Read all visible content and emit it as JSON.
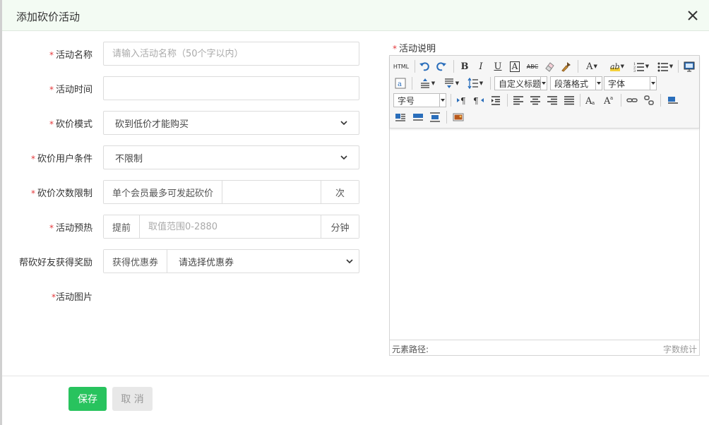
{
  "dialog": {
    "title": "添加砍价活动"
  },
  "form": {
    "name": {
      "label": "活动名称",
      "placeholder": "请输入活动名称（50个字以内）",
      "value": ""
    },
    "time": {
      "label": "活动时间",
      "value": ""
    },
    "mode": {
      "label": "砍价模式",
      "selected": "砍到低价才能购买"
    },
    "user_condition": {
      "label": "砍价用户条件",
      "selected": "不限制"
    },
    "times_limit": {
      "label": "砍价次数限制",
      "prefix": "单个会员最多可发起砍价",
      "value": "",
      "suffix": "次"
    },
    "preheat": {
      "label": "活动预热",
      "prefix": "提前",
      "placeholder": "取值范围0-2880",
      "value": "",
      "suffix": "分钟"
    },
    "help_reward": {
      "label": "帮砍好友获得奖励",
      "prefix": "获得优惠券",
      "selected": "请选择优惠券"
    },
    "image": {
      "label": "活动图片"
    },
    "required_mark": "*"
  },
  "editor": {
    "label": "活动说明",
    "html_btn": "HTML",
    "bold": "B",
    "italic": "I",
    "underline": "U",
    "boxed": "A",
    "strike": "ABC",
    "font_color": "A",
    "highlight": "ab",
    "combo_title": "自定义标题",
    "combo_paragraph": "段落格式",
    "combo_font": "字体",
    "combo_size": "字号",
    "path_label": "元素路径:",
    "word_count": "字数统计"
  },
  "buttons": {
    "save": "保存",
    "cancel": "取 消"
  },
  "colors": {
    "save": "#28c35e",
    "header_bg": "#f3fbf3",
    "required": "#e4393c"
  }
}
